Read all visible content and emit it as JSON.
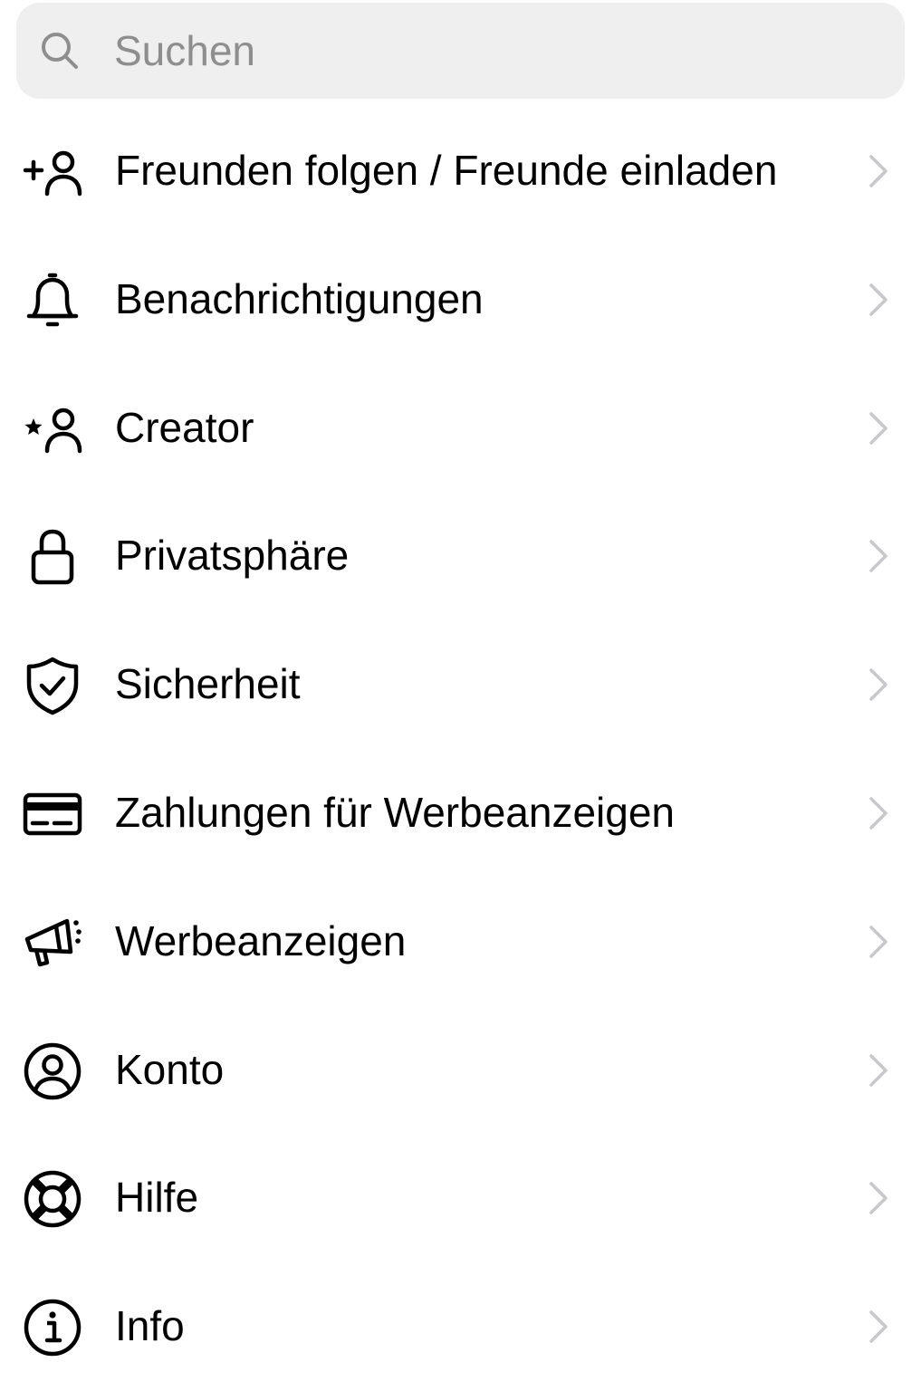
{
  "search": {
    "placeholder": "Suchen",
    "icon": "search-icon"
  },
  "menu": {
    "items": [
      {
        "label": "Freunden folgen / Freunde einladen",
        "icon": "add-person-icon"
      },
      {
        "label": "Benachrichtigungen",
        "icon": "bell-icon"
      },
      {
        "label": "Creator",
        "icon": "star-person-icon"
      },
      {
        "label": "Privatsphäre",
        "icon": "lock-icon"
      },
      {
        "label": "Sicherheit",
        "icon": "shield-check-icon"
      },
      {
        "label": "Zahlungen für Werbeanzeigen",
        "icon": "credit-card-icon"
      },
      {
        "label": "Werbeanzeigen",
        "icon": "megaphone-icon"
      },
      {
        "label": "Konto",
        "icon": "account-circle-icon"
      },
      {
        "label": "Hilfe",
        "icon": "lifebuoy-icon"
      },
      {
        "label": "Info",
        "icon": "info-icon"
      }
    ]
  },
  "colors": {
    "background": "#ffffff",
    "search_background": "#efefef",
    "placeholder": "#8e8e8e",
    "text": "#000000",
    "chevron": "#c7c7cc"
  }
}
